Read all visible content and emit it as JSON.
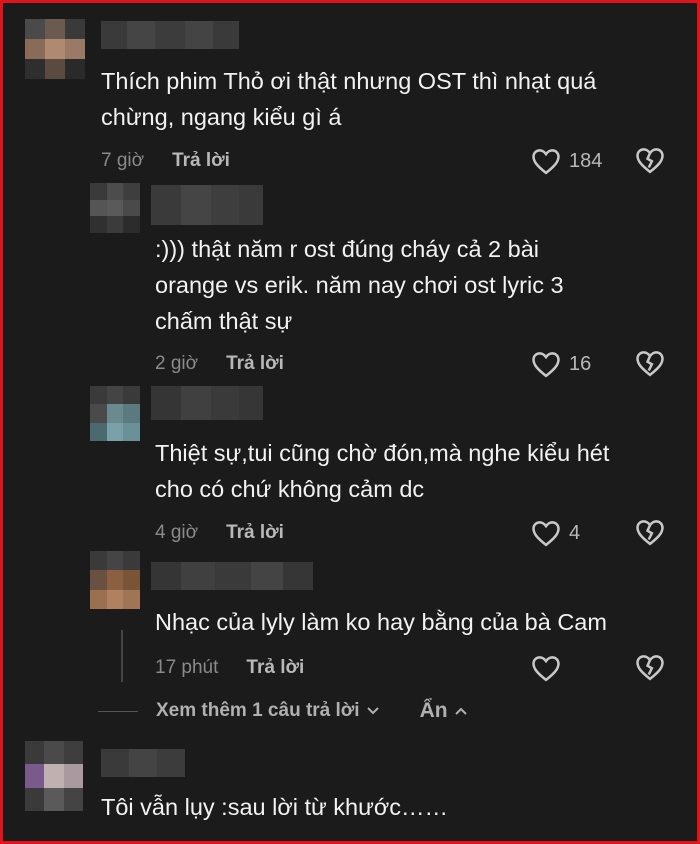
{
  "comments": [
    {
      "text_lines": [
        "Thích phim Thỏ ơi thật nhưng OST thì nhạt quá",
        "chừng, ngang kiểu gì á"
      ],
      "time": "7 giờ",
      "reply_label": "Trả lời",
      "likes": "184"
    },
    {
      "text_lines": [
        ":))) thật năm r ost đúng cháy cả 2 bài",
        "orange vs erik. năm nay chơi ost lyric 3",
        "chấm thật sự"
      ],
      "time": "2 giờ",
      "reply_label": "Trả lời",
      "likes": "16"
    },
    {
      "text_lines": [
        "Thiệt sự,tui cũng chờ đón,mà nghe kiểu hét",
        "cho có chứ không cảm dc"
      ],
      "time": "4 giờ",
      "reply_label": "Trả lời",
      "likes": "4"
    },
    {
      "text_lines": [
        "Nhạc của lyly làm ko hay bằng của bà Cam"
      ],
      "time": "17 phút",
      "reply_label": "Trả lời",
      "likes": ""
    },
    {
      "text_lines": [
        "Tôi vẫn lụy :sau lời từ khước……"
      ]
    }
  ],
  "thread_controls": {
    "view_more": "Xem thêm 1 câu trả lời",
    "hide": "Ẩn"
  },
  "colors": {
    "background": "#1b1b1b",
    "frame_border": "#e0141b",
    "text": "#f2f2f2",
    "muted": "#8a8a8a"
  },
  "icons": [
    "heart-outline-icon",
    "broken-heart-icon",
    "chevron-down-icon",
    "chevron-up-icon"
  ]
}
